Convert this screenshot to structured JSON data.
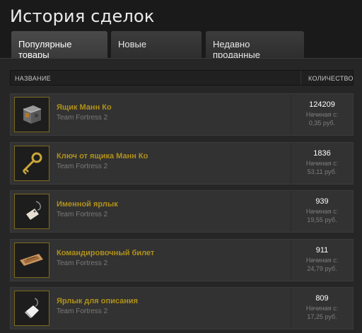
{
  "title": "История сделок",
  "tabs": [
    {
      "label": "Популярные товары",
      "active": true
    },
    {
      "label": "Новые",
      "active": false
    },
    {
      "label": "Недавно проданные",
      "active": false
    }
  ],
  "table": {
    "col_name": "НАЗВАНИЕ",
    "col_qty": "КОЛИЧЕСТВО",
    "rows": [
      {
        "name": "Ящик Манн Ко",
        "game": "Team Fortress 2",
        "qty": "124209",
        "from": "Начиная с:",
        "price": "0,35 руб.",
        "icon": "crate-icon"
      },
      {
        "name": "Ключ от ящика Манн Ко",
        "game": "Team Fortress 2",
        "qty": "1836",
        "from": "Начиная с:",
        "price": "53,11 руб.",
        "icon": "key-icon"
      },
      {
        "name": "Именной ярлык",
        "game": "Team Fortress 2",
        "qty": "939",
        "from": "Начиная с:",
        "price": "19,55 руб.",
        "icon": "name-tag-icon"
      },
      {
        "name": "Командировочный билет",
        "game": "Team Fortress 2",
        "qty": "911",
        "from": "Начиная с:",
        "price": "24,79 руб.",
        "icon": "ticket-icon"
      },
      {
        "name": "Ярлык для описания",
        "game": "Team Fortress 2",
        "qty": "809",
        "from": "Начиная с:",
        "price": "17,25 руб.",
        "icon": "description-tag-icon"
      }
    ]
  },
  "colors": {
    "item_name": "#b0911a",
    "background": "#1a1a1a",
    "row": "#323232"
  }
}
